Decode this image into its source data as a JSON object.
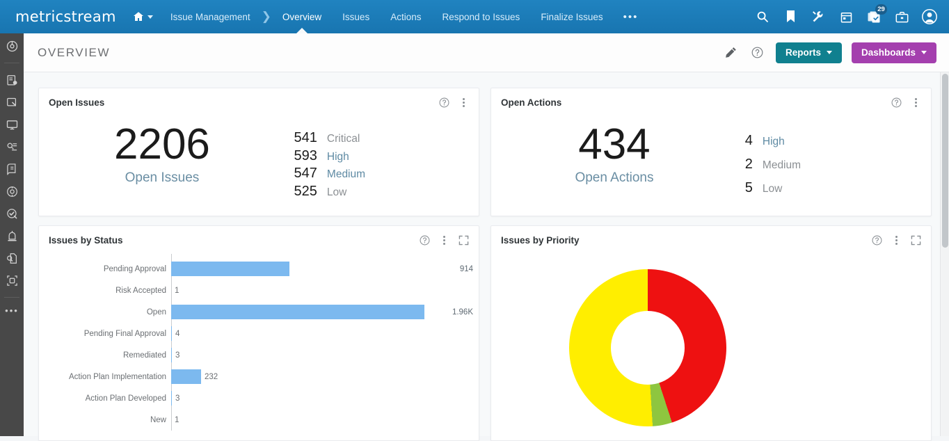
{
  "topbar": {
    "brand": "metricstream",
    "home_icon": "home-icon",
    "breadcrumb_root": "Issue Management",
    "nav_items": [
      {
        "label": "Overview",
        "active": true
      },
      {
        "label": "Issues",
        "active": false
      },
      {
        "label": "Actions",
        "active": false
      },
      {
        "label": "Respond to Issues",
        "active": false
      },
      {
        "label": "Finalize Issues",
        "active": false
      }
    ],
    "more_label": "•••",
    "right_icons": [
      {
        "name": "search-icon"
      },
      {
        "name": "bookmark-icon"
      },
      {
        "name": "tools-icon"
      },
      {
        "name": "calendar-icon"
      },
      {
        "name": "tasks-icon",
        "badge": "29"
      },
      {
        "name": "briefcase-icon"
      },
      {
        "name": "user-avatar-icon"
      }
    ],
    "bg_color": "#1c7cba"
  },
  "sidebar": {
    "items": [
      {
        "name": "sidebar-item-dashboard"
      },
      {
        "name": "sidebar-item-reports"
      },
      {
        "name": "sidebar-item-forms"
      },
      {
        "name": "sidebar-item-monitor"
      },
      {
        "name": "sidebar-item-analytics"
      },
      {
        "name": "sidebar-item-library"
      },
      {
        "name": "sidebar-item-settings"
      },
      {
        "name": "sidebar-item-compliance"
      },
      {
        "name": "sidebar-item-alerts"
      },
      {
        "name": "sidebar-item-search-docs"
      },
      {
        "name": "sidebar-item-integrations"
      }
    ],
    "more_label": "•••"
  },
  "page_header": {
    "title": "OVERVIEW",
    "edit_icon": "pencil-icon",
    "help_icon": "help-circle-icon",
    "reports_label": "Reports",
    "dashboards_label": "Dashboards",
    "reports_color": "#10808f",
    "dashboards_color": "#a43fae"
  },
  "cards": {
    "open_issues": {
      "title": "Open Issues",
      "total": "2206",
      "total_label": "Open Issues",
      "breakdown": [
        {
          "value": "541",
          "label": "Critical"
        },
        {
          "value": "593",
          "label": "High"
        },
        {
          "value": "547",
          "label": "Medium"
        },
        {
          "value": "525",
          "label": "Low"
        }
      ]
    },
    "open_actions": {
      "title": "Open Actions",
      "total": "434",
      "total_label": "Open Actions",
      "breakdown": [
        {
          "value": "4",
          "label": "High"
        },
        {
          "value": "2",
          "label": "Medium"
        },
        {
          "value": "5",
          "label": "Low"
        }
      ]
    },
    "issues_by_status": {
      "title": "Issues by Status"
    },
    "issues_by_priority": {
      "title": "Issues by Priority"
    }
  },
  "chart_data": [
    {
      "type": "bar",
      "title": "Issues by Status",
      "orientation": "horizontal",
      "xlabel": "",
      "ylabel": "",
      "grid": false,
      "legend": false,
      "bar_color": "#7cb9ef",
      "xlim": [
        0,
        1960
      ],
      "categories": [
        "Pending Approval",
        "Risk Accepted",
        "Open",
        "Pending Final Approval",
        "Remediated",
        "Action Plan Implementation",
        "Action Plan Developed",
        "New"
      ],
      "values": [
        914,
        1,
        1960,
        4,
        3,
        232,
        3,
        1
      ],
      "value_labels": [
        "914",
        "1",
        "1.96K",
        "4",
        "3",
        "232",
        "3",
        "1"
      ]
    },
    {
      "type": "pie",
      "subtype": "donut",
      "title": "Issues by Priority",
      "legend": false,
      "labels": [
        "Red",
        "Green",
        "Yellow"
      ],
      "values": [
        45,
        4,
        51
      ],
      "colors": [
        "#ee1111",
        "#8ec63f",
        "#ffee00"
      ]
    }
  ],
  "scrollbar": {
    "name": "vertical-scrollbar"
  }
}
